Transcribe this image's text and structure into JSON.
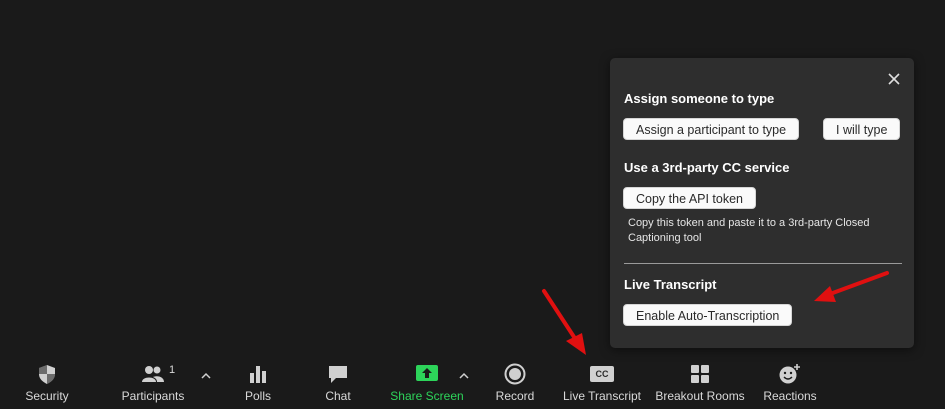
{
  "panel": {
    "close_icon": "close-icon",
    "assign_heading": "Assign someone to type",
    "assign_participant_label": "Assign a participant to type",
    "i_will_type_label": "I will type",
    "cc_heading": "Use a 3rd-party CC service",
    "copy_api_label": "Copy the API token",
    "copy_desc": "Copy this token and paste it to a 3rd-party Closed Captioning tool",
    "live_heading": "Live Transcript",
    "enable_auto_label": "Enable Auto-Transcription"
  },
  "toolbar": {
    "participants_count": "1",
    "items": [
      {
        "label": "Security",
        "icon": "shield-icon"
      },
      {
        "label": "Participants",
        "icon": "participants-icon"
      },
      {
        "label": "Polls",
        "icon": "polls-icon"
      },
      {
        "label": "Chat",
        "icon": "chat-icon"
      },
      {
        "label": "Share Screen",
        "icon": "share-screen-icon"
      },
      {
        "label": "Record",
        "icon": "record-icon"
      },
      {
        "label": "Live Transcript",
        "icon": "cc-icon"
      },
      {
        "label": "Breakout Rooms",
        "icon": "breakout-rooms-icon"
      },
      {
        "label": "Reactions",
        "icon": "reactions-icon"
      }
    ],
    "cc_badge": "CC"
  },
  "colors": {
    "background": "#1a1a1a",
    "panel": "#2e2e2e",
    "share_green": "#2dd45a",
    "arrow_red": "#e01010"
  }
}
